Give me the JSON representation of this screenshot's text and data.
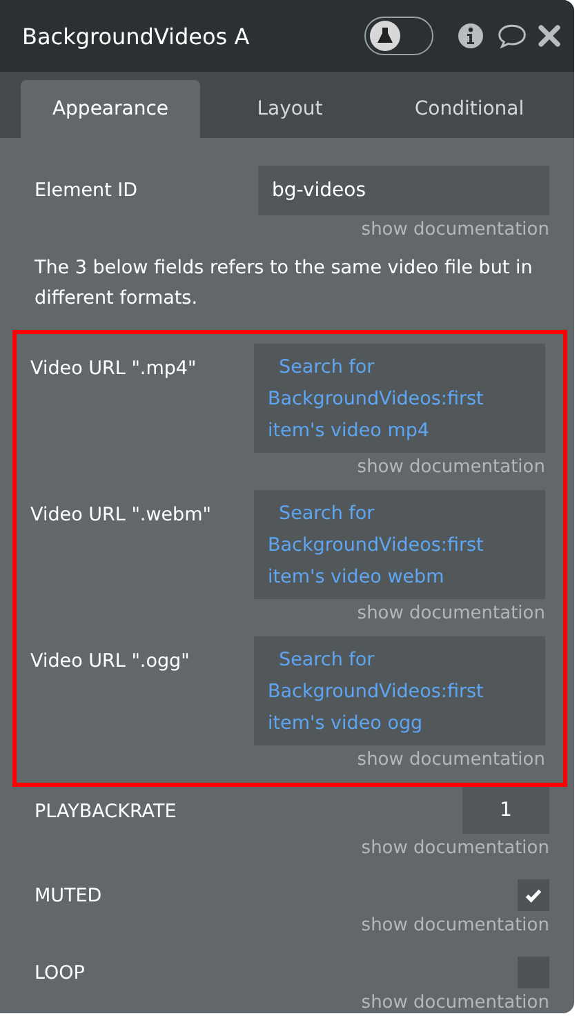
{
  "window": {
    "title": "BackgroundVideos A",
    "test_mode_on": false
  },
  "tabs": [
    {
      "label": "Appearance",
      "selected": true
    },
    {
      "label": "Layout",
      "selected": false
    },
    {
      "label": "Conditional",
      "selected": false
    }
  ],
  "fields_before": [
    {
      "kind": "text",
      "label": "Element ID",
      "value": "bg-videos",
      "doc": "show documentation"
    }
  ],
  "note": "The 3 below fields refers to the same video file but in different formats.",
  "highlighted_fields": [
    {
      "kind": "expression",
      "label": "Video URL \".mp4\"",
      "value": "Search for BackgroundVideos:first item's video mp4",
      "doc": "show documentation"
    },
    {
      "kind": "expression",
      "label": "Video URL \".webm\"",
      "value": "Search for BackgroundVideos:first item's video webm",
      "doc": "show documentation"
    },
    {
      "kind": "expression",
      "label": "Video URL \".ogg\"",
      "value": "Search for BackgroundVideos:first item's video ogg",
      "doc": "show documentation"
    }
  ],
  "fields_after": [
    {
      "kind": "number",
      "label": "PLAYBACKRATE",
      "value": "1",
      "doc": "show documentation"
    },
    {
      "kind": "checkbox",
      "label": "MUTED",
      "checked": true,
      "doc": "show documentation"
    },
    {
      "kind": "checkbox",
      "label": "LOOP",
      "checked": false,
      "doc": "show documentation"
    }
  ]
}
